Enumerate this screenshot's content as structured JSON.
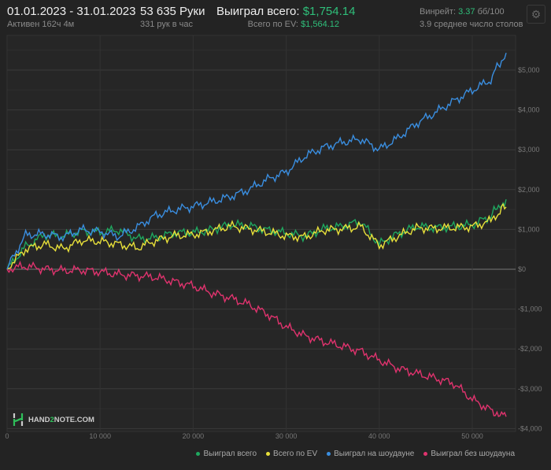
{
  "header": {
    "date_range": "01.01.2023 - 31.01.2023",
    "active": "Активен 162ч 4м",
    "hands": "53 635 Руки",
    "hands_per_hour": "331 рук в час",
    "won_label": "Выиграл всего:",
    "won_value": "$1,754.14",
    "ev_label": "Всего по EV:",
    "ev_value": "$1,564.12",
    "winrate_label": "Винрейт:",
    "winrate_value": "3.37",
    "winrate_unit": "бб/100",
    "tables": "3.9 среднее число столов",
    "settings_icon": "gear-icon"
  },
  "logo": {
    "text_a": "HAND",
    "text_b": "2",
    "text_c": "NOTE.COM"
  },
  "chart_data": {
    "type": "line",
    "xlabel": "",
    "ylabel": "",
    "xlim": [
      0,
      54000
    ],
    "ylim": [
      -4000,
      5500
    ],
    "x_ticks": [
      "0",
      "10 000",
      "20 000",
      "30 000",
      "40 000",
      "50 000"
    ],
    "x_tick_values": [
      0,
      10000,
      20000,
      30000,
      40000,
      50000
    ],
    "y_ticks": [
      "$5,000",
      "$4,000",
      "$3,000",
      "$2,000",
      "$1,000",
      "$0",
      "-$1,000",
      "-$2,000",
      "-$3,000",
      "-$4,000"
    ],
    "y_tick_values": [
      5000,
      4000,
      3000,
      2000,
      1000,
      0,
      -1000,
      -2000,
      -3000,
      -4000
    ],
    "legend_position": "bottom-right",
    "x": [
      0,
      2000,
      4000,
      6000,
      8000,
      10000,
      12000,
      14000,
      16000,
      18000,
      20000,
      22000,
      24000,
      26000,
      28000,
      30000,
      32000,
      34000,
      36000,
      38000,
      40000,
      42000,
      44000,
      46000,
      48000,
      50000,
      52000,
      53635
    ],
    "series": [
      {
        "name": "Выиграл всего",
        "color": "#1fa85f",
        "values": [
          0,
          600,
          900,
          850,
          950,
          900,
          950,
          750,
          800,
          950,
          950,
          1000,
          1100,
          1050,
          950,
          900,
          850,
          1050,
          1100,
          1200,
          600,
          850,
          1050,
          1050,
          1100,
          1150,
          1350,
          1754
        ]
      },
      {
        "name": "Всего по EV",
        "color": "#e8e03a",
        "values": [
          0,
          500,
          650,
          550,
          750,
          700,
          600,
          500,
          700,
          850,
          900,
          1000,
          1100,
          1000,
          900,
          800,
          800,
          1000,
          1050,
          1100,
          600,
          800,
          1000,
          1000,
          1050,
          1100,
          1250,
          1564
        ]
      },
      {
        "name": "Выиграл на шоудауне",
        "color": "#3a8ee0",
        "values": [
          0,
          830,
          870,
          830,
          1030,
          970,
          830,
          1030,
          1320,
          1460,
          1580,
          1720,
          1860,
          2020,
          2250,
          2410,
          2800,
          3040,
          3200,
          3300,
          3040,
          3300,
          3640,
          3890,
          4190,
          4490,
          4780,
          5430
        ]
      },
      {
        "name": "Выиграл без шоудауна",
        "color": "#e0336e",
        "values": [
          0,
          50,
          -30,
          -50,
          -10,
          -30,
          -100,
          -150,
          -220,
          -350,
          -450,
          -600,
          -700,
          -850,
          -1100,
          -1450,
          -1700,
          -1850,
          -1950,
          -2050,
          -2250,
          -2450,
          -2600,
          -2750,
          -2900,
          -3300,
          -3550,
          -3700
        ]
      }
    ]
  }
}
